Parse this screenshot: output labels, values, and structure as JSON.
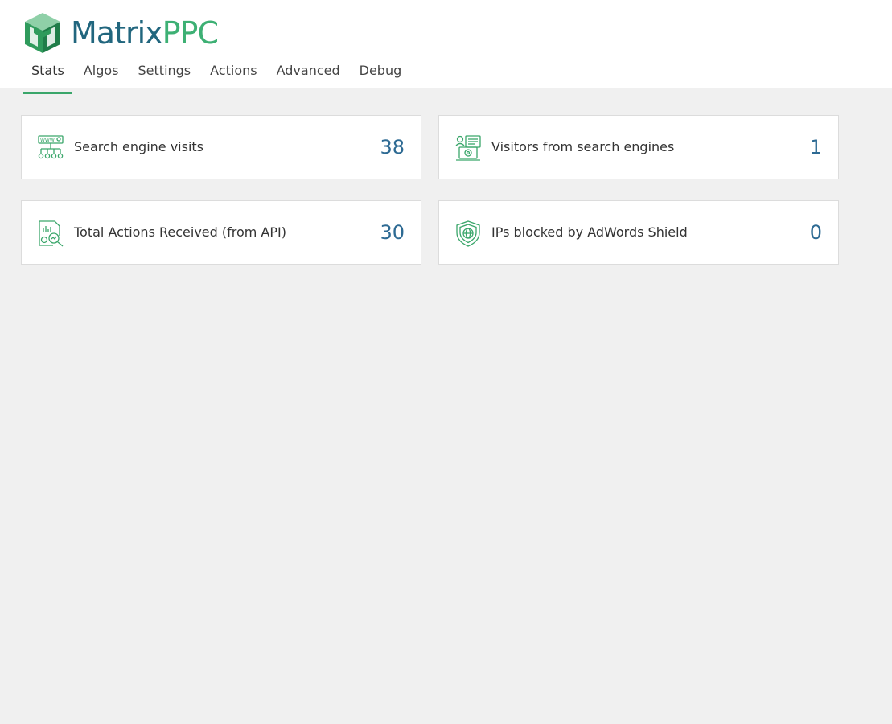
{
  "app": {
    "logo_matrix": "Matrix",
    "logo_ppc": "PPC",
    "brand_dark": "#21667e",
    "brand_green": "#3db074"
  },
  "tabs": [
    {
      "label": "Stats",
      "active": true
    },
    {
      "label": "Algos"
    },
    {
      "label": "Settings"
    },
    {
      "label": "Actions"
    },
    {
      "label": "Advanced"
    },
    {
      "label": "Debug"
    }
  ],
  "stats": [
    {
      "label": "Search engine visits",
      "value": "38",
      "icon": "sitemap-www-icon"
    },
    {
      "label": "Visitors from search engines",
      "value": "1",
      "icon": "visitor-analytics-icon"
    },
    {
      "label": "Total Actions Received (from API)",
      "value": "30",
      "icon": "report-search-icon"
    },
    {
      "label": "IPs blocked by AdWords Shield",
      "value": "0",
      "icon": "shield-globe-icon"
    }
  ]
}
